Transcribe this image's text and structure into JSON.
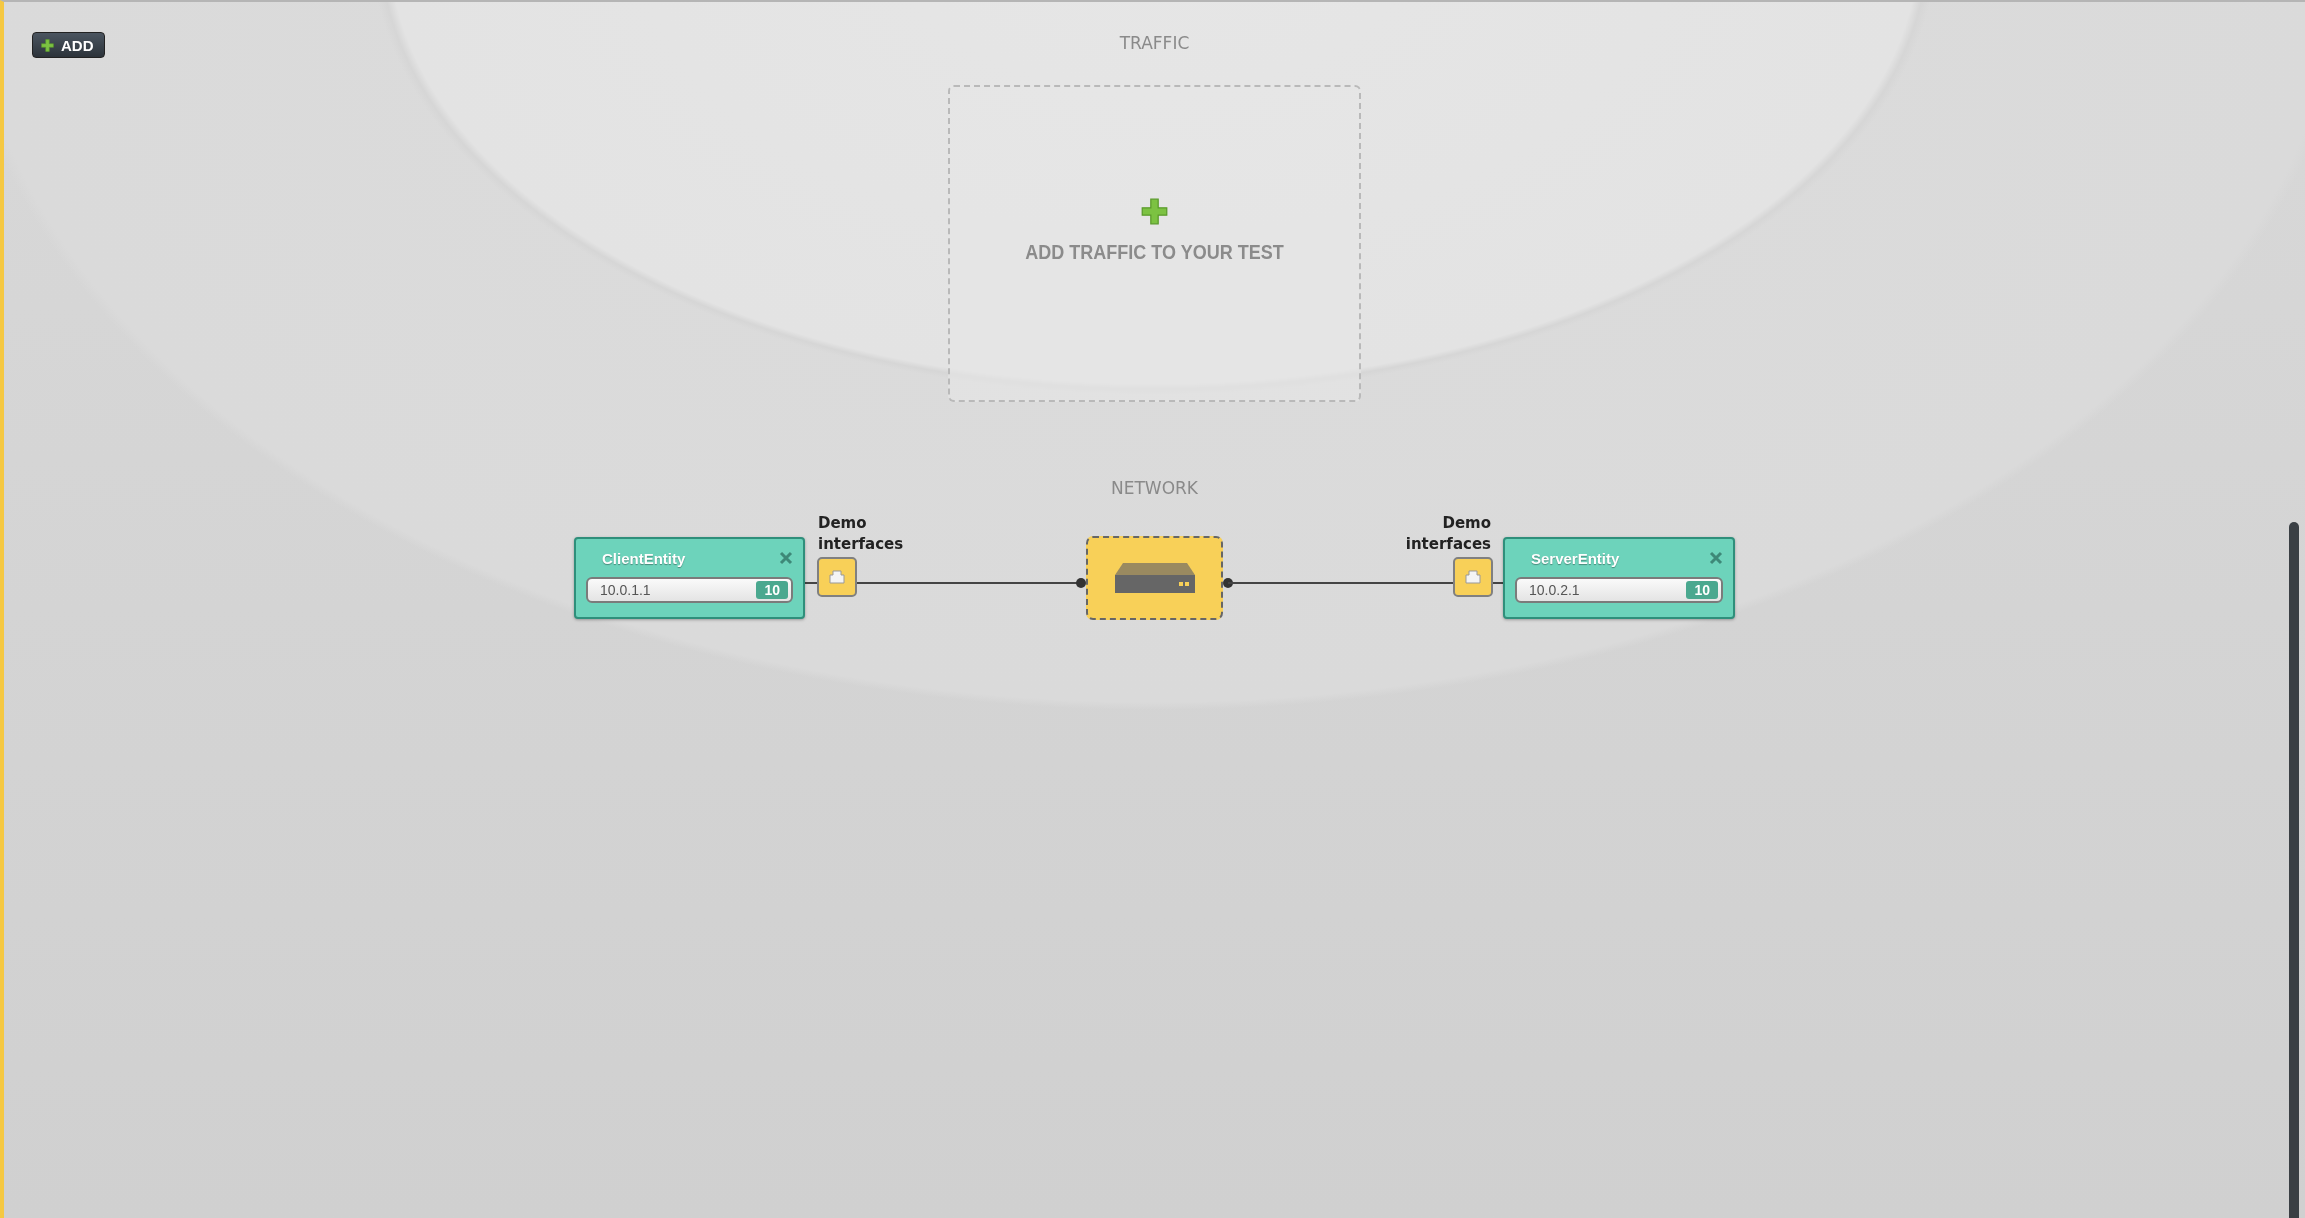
{
  "toolbar": {
    "add_button": "ADD"
  },
  "traffic": {
    "title": "TRAFFIC",
    "prompt": "ADD TRAFFIC TO YOUR TEST"
  },
  "network": {
    "title": "NETWORK",
    "entities": [
      {
        "name": "ClientEntity",
        "address": "10.0.1.1",
        "count": "10",
        "port_label": "Demo interfaces"
      },
      {
        "name": "ServerEntity",
        "address": "10.0.2.1",
        "count": "10",
        "port_label": "Demo interfaces"
      }
    ]
  }
}
